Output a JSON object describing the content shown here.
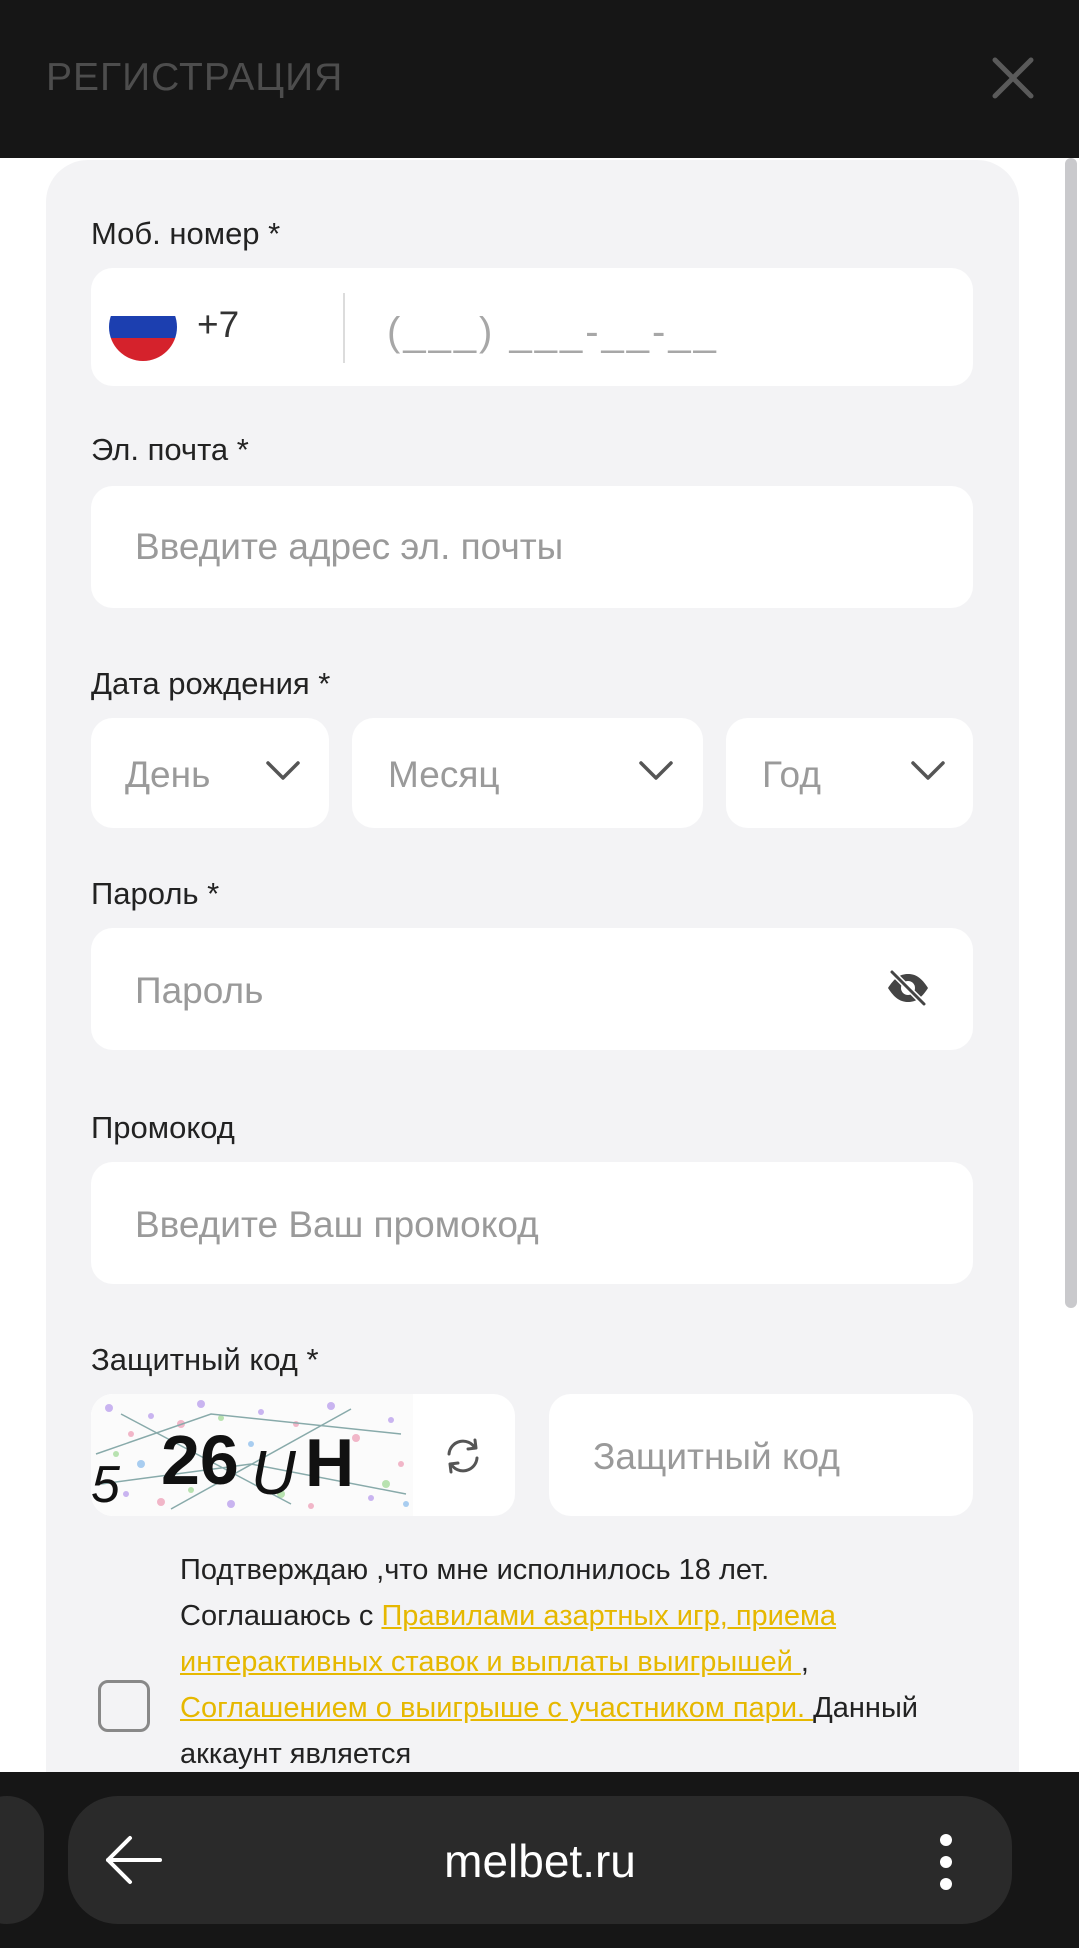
{
  "header": {
    "title": "РЕГИСТРАЦИЯ",
    "close_icon": "close-icon"
  },
  "phone": {
    "label": "Моб. номер *",
    "country_code": "+7",
    "mask": "(___) ___-__-__",
    "flag": "russia-flag-icon"
  },
  "email": {
    "label": "Эл. почта *",
    "placeholder": "Введите адрес эл. почты"
  },
  "birthdate": {
    "label": "Дата рождения *",
    "day": "День",
    "month": "Месяц",
    "year": "Год"
  },
  "password": {
    "label": "Пароль *",
    "placeholder": "Пароль",
    "toggle_icon": "eye-off-icon"
  },
  "promo": {
    "label": "Промокод",
    "placeholder": "Введите Ваш промокод"
  },
  "captcha": {
    "label": "Защитный код *",
    "image_text": "5 26UH",
    "placeholder": "Защитный код",
    "refresh_icon": "refresh-icon"
  },
  "agreement": {
    "line1": "Подтверждаю ,что мне исполнилось 18 лет.",
    "line2_prefix": "Соглашаюсь с ",
    "link1": "Правилами азартных игр, приема интерактивных ставок и выплаты выигрышей ",
    "sep": ", ",
    "link2": "Соглашением о выигрыше с участником пари. ",
    "suffix": "Данный аккаунт является"
  },
  "browser": {
    "url": "melbet.ru"
  },
  "colors": {
    "accent": "#e6b800",
    "card": "#f3f3f5",
    "bar": "#161616"
  }
}
